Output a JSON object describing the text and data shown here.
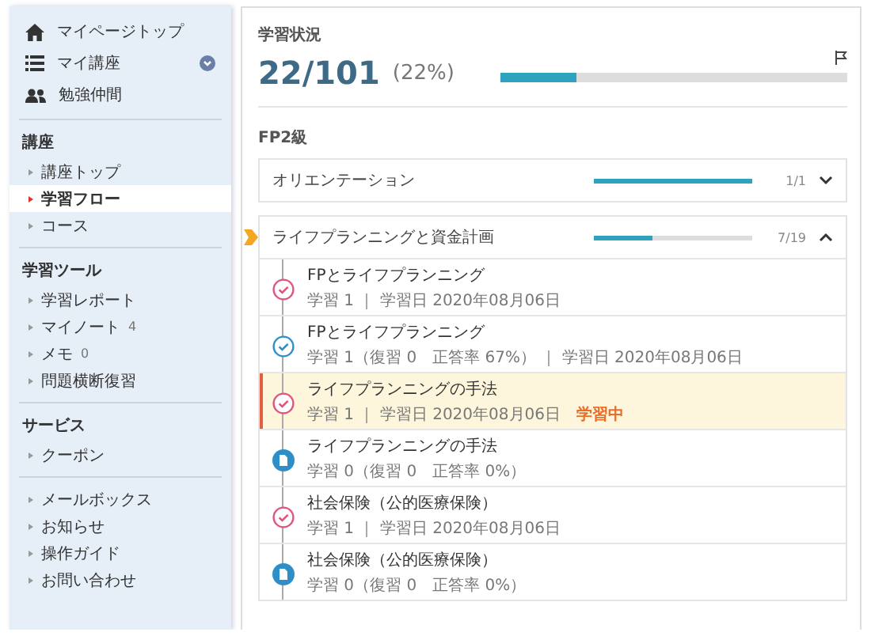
{
  "sidebar": {
    "top_items": [
      {
        "label": "マイページトップ",
        "kind": "home",
        "has_menu": false
      },
      {
        "label": "マイ講座",
        "kind": "list",
        "has_menu": true
      },
      {
        "label": "勉強仲間",
        "kind": "people",
        "has_menu": false
      }
    ],
    "sections": [
      {
        "heading": "講座",
        "items": [
          {
            "label": "講座トップ",
            "selected": false
          },
          {
            "label": "学習フロー",
            "selected": true
          },
          {
            "label": "コース",
            "selected": false
          }
        ]
      },
      {
        "heading": "学習ツール",
        "items": [
          {
            "label": "学習レポート",
            "selected": false
          },
          {
            "label": "マイノート",
            "count": "4",
            "selected": false
          },
          {
            "label": "メモ",
            "count": "0",
            "selected": false
          },
          {
            "label": "問題横断復習",
            "selected": false
          }
        ]
      },
      {
        "heading": "サービス",
        "items": [
          {
            "label": "クーポン",
            "selected": false
          }
        ]
      },
      {
        "items": [
          {
            "label": "メールボックス",
            "selected": false
          },
          {
            "label": "お知らせ",
            "selected": false
          },
          {
            "label": "操作ガイド",
            "selected": false
          },
          {
            "label": "お問い合わせ",
            "selected": false
          }
        ]
      }
    ]
  },
  "status": {
    "heading": "学習状況",
    "count": "22/101",
    "percent": "(22%)",
    "level": 0.22
  },
  "course": {
    "name": "FP2級",
    "units": [
      {
        "title": "オリエンテーション",
        "level": 1,
        "count": "1/1",
        "expanded": false,
        "current": false
      },
      {
        "title": "ライフプランニングと資金計画",
        "level": 0.37,
        "count": "7/19",
        "expanded": true,
        "current": true,
        "lessons": [
          {
            "kind": "complete",
            "title": "FPとライフプランニング",
            "meta": "学習 1 ｜ 学習日 2020年08月06日",
            "selected": false
          },
          {
            "kind": "reviewed",
            "title": "FPとライフプランニング",
            "meta": "学習 1（復習 0　正答率 67%） ｜ 学習日 2020年08月06日",
            "selected": false
          },
          {
            "kind": "complete",
            "title": "ライフプランニングの手法",
            "meta": "学習 1 ｜ 学習日 2020年08月06日",
            "tag": "学習中",
            "selected": true
          },
          {
            "kind": "unstarted",
            "title": "ライフプランニングの手法",
            "meta": "学習 0（復習 0　正答率 0%）",
            "selected": false
          },
          {
            "kind": "complete",
            "title": "社会保険（公的医療保険）",
            "meta": "学習 1 ｜ 学習日 2020年08月06日",
            "selected": false
          },
          {
            "kind": "unstarted",
            "title": "社会保険（公的医療保険）",
            "meta": "学習 0（復習 0　正答率 0%）",
            "selected": false
          }
        ]
      }
    ]
  }
}
